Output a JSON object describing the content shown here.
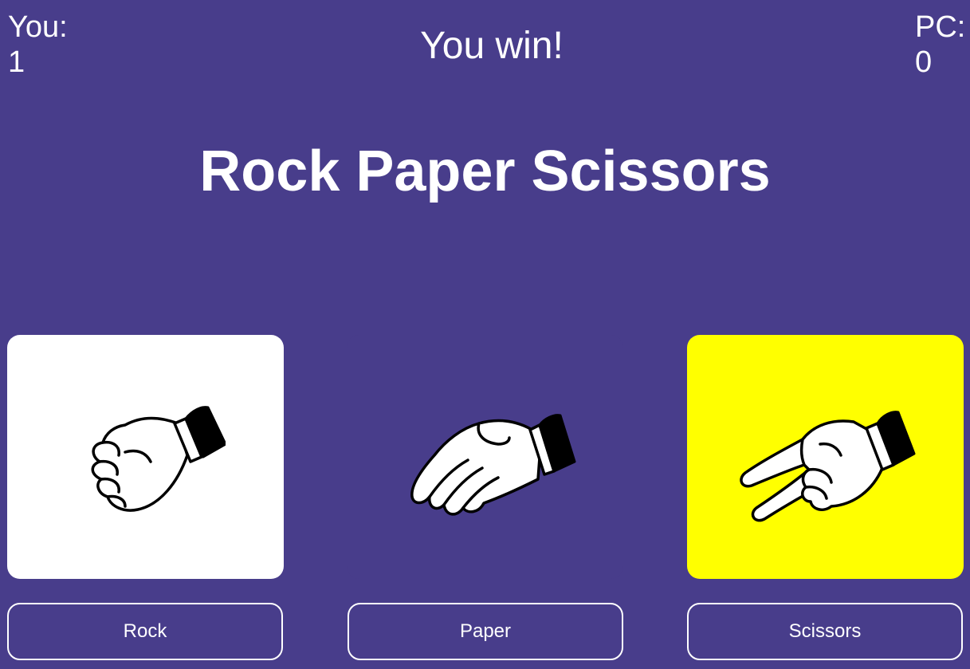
{
  "scoreboard": {
    "you_label": "You:",
    "you_score": "1",
    "pc_label": "PC:",
    "pc_score": "0"
  },
  "result_text": "You win!",
  "title": "Rock Paper Scissors",
  "choices": [
    {
      "id": "rock",
      "button_label": "Rock",
      "icon": "fist-hand-icon",
      "card_color": "#ffffff",
      "state": "player-choice"
    },
    {
      "id": "paper",
      "button_label": "Paper",
      "icon": "open-hand-icon",
      "card_color": "#483d8b",
      "state": "none"
    },
    {
      "id": "scissors",
      "button_label": "Scissors",
      "icon": "two-finger-hand-icon",
      "card_color": "#ffff00",
      "state": "pc-choice"
    }
  ],
  "colors": {
    "background": "#483d8b",
    "text": "#ffffff",
    "highlight": "#ffff00"
  }
}
